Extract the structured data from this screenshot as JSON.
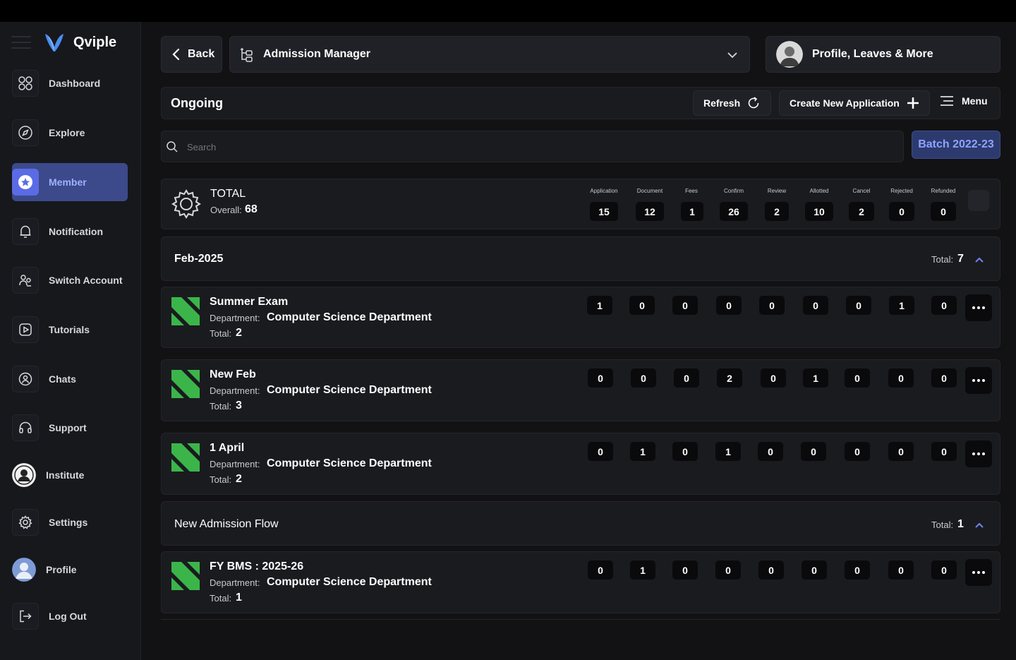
{
  "brand": {
    "name": "Qviple"
  },
  "sidebar": {
    "items": [
      {
        "label": "Dashboard",
        "icon": "grid-icon"
      },
      {
        "label": "Explore",
        "icon": "compass-icon"
      },
      {
        "label": "Member",
        "icon": "member-icon",
        "active": true
      },
      {
        "label": "Notification",
        "icon": "bell-icon"
      },
      {
        "label": "Switch Account",
        "icon": "switch-account-icon"
      },
      {
        "label": "Tutorials",
        "icon": "play-icon"
      },
      {
        "label": "Chats",
        "icon": "chat-icon"
      },
      {
        "label": "Support",
        "icon": "headset-icon"
      },
      {
        "label": "Institute",
        "icon": "institute-avatar"
      },
      {
        "label": "Settings",
        "icon": "gear-icon"
      },
      {
        "label": "Profile",
        "icon": "profile-avatar"
      },
      {
        "label": "Log Out",
        "icon": "logout-icon"
      }
    ]
  },
  "header": {
    "back_label": "Back",
    "module_title": "Admission Manager",
    "profile_label": "Profile, Leaves & More"
  },
  "toolbar": {
    "title": "Ongoing",
    "refresh_label": "Refresh",
    "create_label": "Create New Application",
    "menu_label": "Menu"
  },
  "search": {
    "placeholder": "Search"
  },
  "batch": {
    "label": "Batch 2022-23"
  },
  "colors": {
    "accent": "#5b6be6",
    "brand_green": "#3bb54a",
    "batch_bg": "#2d3a6e",
    "batch_text": "#8ea3ff"
  },
  "summary": {
    "title": "TOTAL",
    "overall_label": "Overall:",
    "overall_value": "68",
    "columns": [
      "Application",
      "Document",
      "Fees",
      "Confirm",
      "Review",
      "Allotted",
      "Cancel",
      "Rejected",
      "Refunded"
    ],
    "values": [
      "15",
      "12",
      "1",
      "26",
      "2",
      "10",
      "2",
      "0",
      "0"
    ]
  },
  "groups": [
    {
      "title": "Feb-2025",
      "total_label": "Total:",
      "total_value": "7",
      "apps": [
        {
          "name": "Summer Exam",
          "dept_label": "Department:",
          "dept": "Computer Science Department",
          "total_label": "Total:",
          "total": "2",
          "counts": [
            "1",
            "0",
            "0",
            "0",
            "0",
            "0",
            "0",
            "1",
            "0"
          ]
        },
        {
          "name": "New Feb",
          "dept_label": "Department:",
          "dept": "Computer Science Department",
          "total_label": "Total:",
          "total": "3",
          "counts": [
            "0",
            "0",
            "0",
            "2",
            "0",
            "1",
            "0",
            "0",
            "0"
          ]
        },
        {
          "name": "1 April",
          "dept_label": "Department:",
          "dept": "Computer Science Department",
          "total_label": "Total:",
          "total": "2",
          "counts": [
            "0",
            "1",
            "0",
            "1",
            "0",
            "0",
            "0",
            "0",
            "0"
          ]
        }
      ]
    },
    {
      "title": "New Admission Flow",
      "total_label": "Total:",
      "total_value": "1",
      "apps": [
        {
          "name": "FY BMS : 2025-26",
          "dept_label": "Department:",
          "dept": "Computer Science Department",
          "total_label": "Total:",
          "total": "1",
          "counts": [
            "0",
            "1",
            "0",
            "0",
            "0",
            "0",
            "0",
            "0",
            "0"
          ]
        }
      ]
    }
  ]
}
